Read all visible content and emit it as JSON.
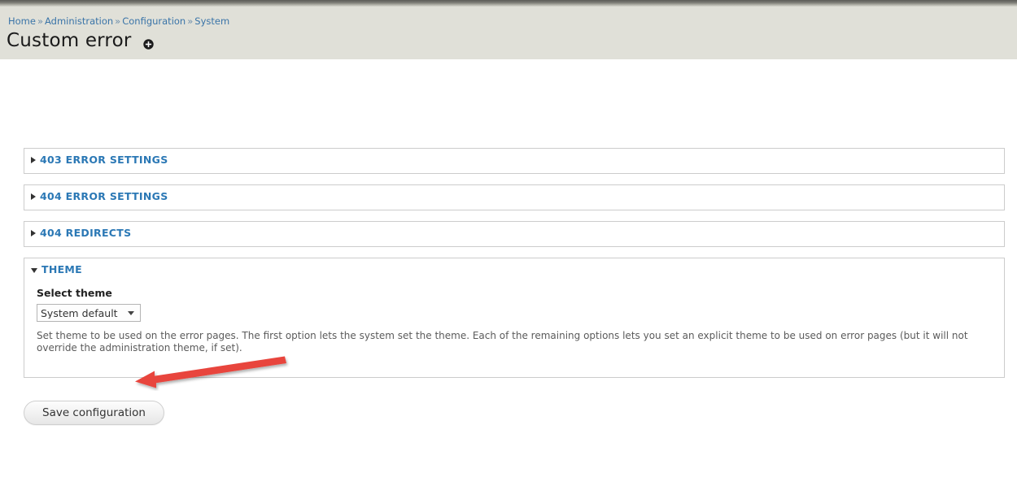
{
  "header": {
    "breadcrumb": [
      {
        "label": "Home"
      },
      {
        "label": "Administration"
      },
      {
        "label": "Configuration"
      },
      {
        "label": "System"
      }
    ],
    "breadcrumb_separator": "»",
    "title": "Custom error",
    "title_icon": "add-circle-icon"
  },
  "form": {
    "fieldsets": [
      {
        "legend": "403 error settings",
        "expanded": false,
        "marker_icon": "triangle-right-icon"
      },
      {
        "legend": "404 error settings",
        "expanded": false,
        "marker_icon": "triangle-right-icon"
      },
      {
        "legend": "404 redirects",
        "expanded": false,
        "marker_icon": "triangle-right-icon"
      },
      {
        "legend": "Theme",
        "expanded": true,
        "marker_icon": "triangle-down-icon"
      }
    ],
    "theme_section": {
      "label": "Select theme",
      "selected_option": "System default",
      "options": [
        "System default"
      ],
      "description": "Set theme to be used on the error pages. The first option lets the system set the theme. Each of the remaining options lets you set an explicit theme to be used on error pages (but it will not override the administration theme, if set)."
    },
    "save_label": "Save configuration"
  },
  "annotation": {
    "type": "arrow",
    "color": "#e8453c",
    "points_to": "theme-select-dropdown",
    "direction": "left"
  },
  "colors": {
    "link_blue": "#3a74a8",
    "legend_blue": "#2b78b5",
    "header_bg": "#e0e0d8",
    "fieldset_border": "#cccccc",
    "annotation_red": "#e8453c"
  }
}
